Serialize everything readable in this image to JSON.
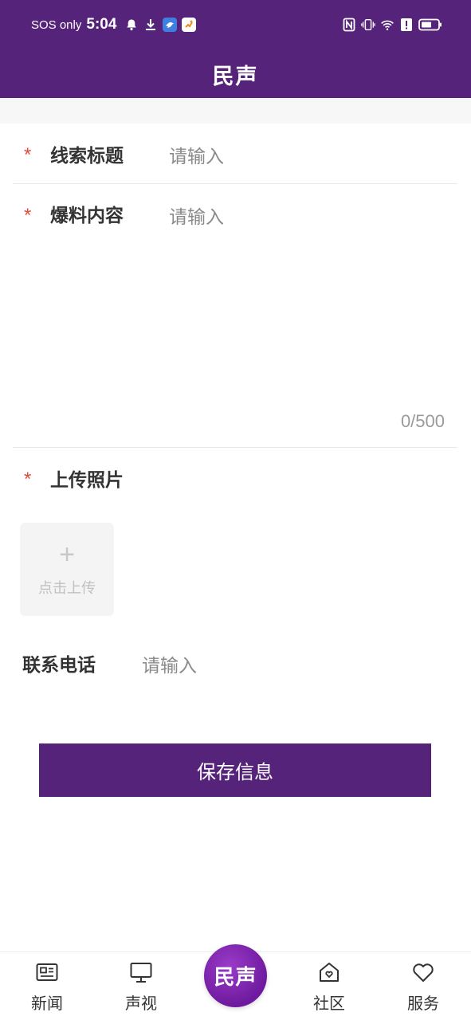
{
  "status_bar": {
    "carrier": "SOS only",
    "time": "5:04"
  },
  "header": {
    "title": "民声"
  },
  "form": {
    "required_mark": "*",
    "title_field": {
      "label": "线索标题",
      "placeholder": "请输入"
    },
    "content_field": {
      "label": "爆料内容",
      "placeholder": "请输入",
      "counter": "0/500"
    },
    "photo_field": {
      "label": "上传照片",
      "upload_plus": "+",
      "upload_label": "点击上传"
    },
    "phone_field": {
      "label": "联系电话",
      "placeholder": "请输入"
    },
    "save_label": "保存信息"
  },
  "tabbar": {
    "items": [
      {
        "label": "新闻",
        "icon": "news-icon"
      },
      {
        "label": "声视",
        "icon": "monitor-icon"
      },
      {
        "label": "民声",
        "icon": "minsheng-logo"
      },
      {
        "label": "社区",
        "icon": "community-home-icon"
      },
      {
        "label": "服务",
        "icon": "heart-icon"
      }
    ]
  },
  "colors": {
    "brand": "#56237a",
    "required": "#e04a3b",
    "placeholder": "#8a8a8a"
  }
}
